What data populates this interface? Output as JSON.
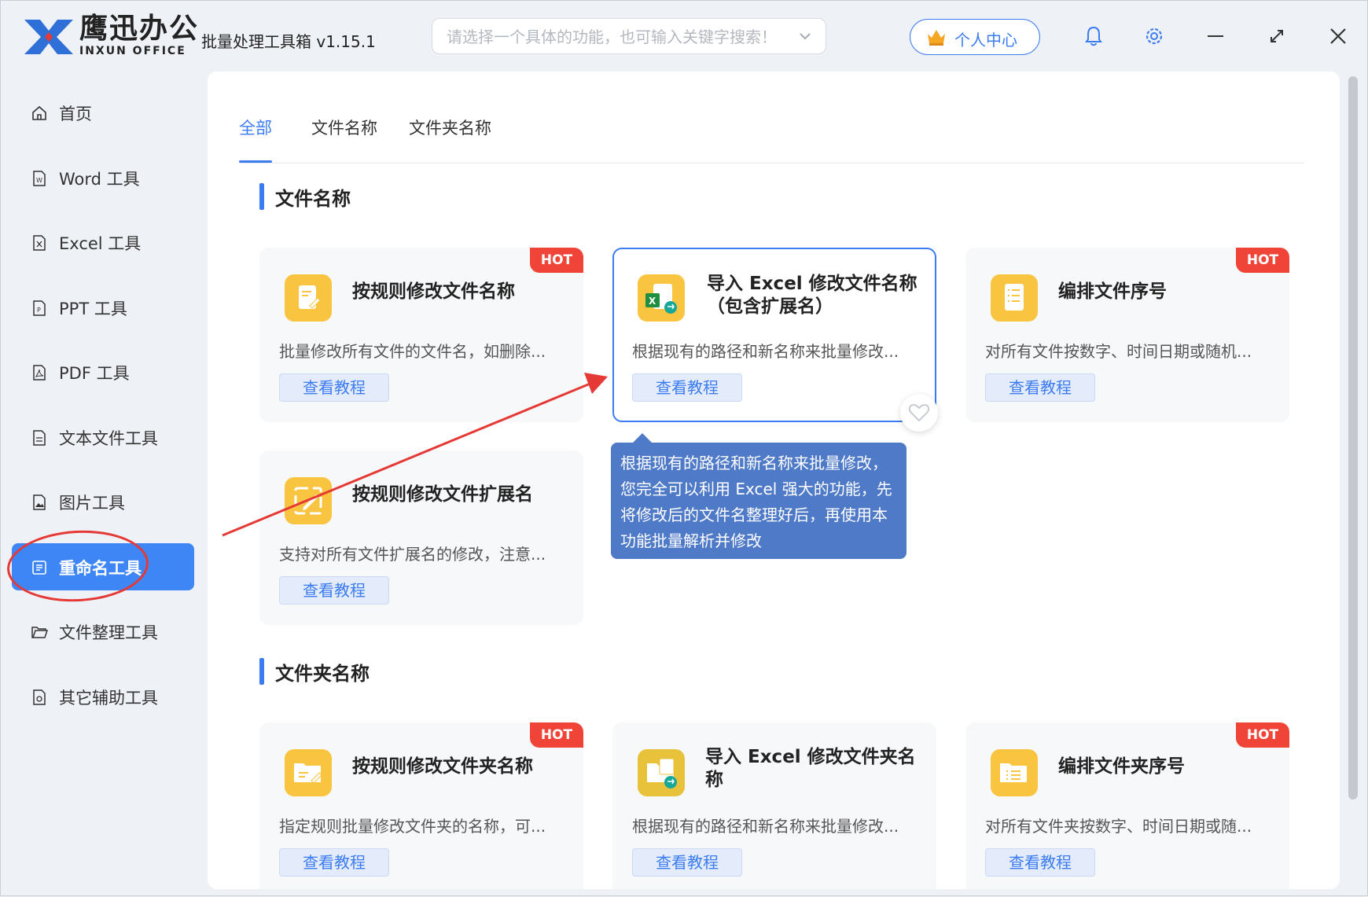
{
  "app": {
    "brand_cn": "鹰迅办公",
    "brand_en": "INXUN OFFICE",
    "title": "批量处理工具箱 v1.15.1"
  },
  "search": {
    "placeholder": "请选择一个具体的功能，也可输入关键字搜索！"
  },
  "header": {
    "user_center": "个人中心"
  },
  "sidebar": {
    "items": [
      {
        "label": "首页",
        "icon": "home-icon"
      },
      {
        "label": "Word 工具",
        "icon": "word-file-icon"
      },
      {
        "label": "Excel 工具",
        "icon": "excel-file-icon"
      },
      {
        "label": "PPT 工具",
        "icon": "ppt-file-icon"
      },
      {
        "label": "PDF 工具",
        "icon": "pdf-file-icon"
      },
      {
        "label": "文本文件工具",
        "icon": "text-file-icon"
      },
      {
        "label": "图片工具",
        "icon": "image-file-icon"
      },
      {
        "label": "重命名工具",
        "icon": "rename-icon",
        "active": true
      },
      {
        "label": "文件整理工具",
        "icon": "folder-open-icon"
      },
      {
        "label": "其它辅助工具",
        "icon": "utility-icon"
      }
    ]
  },
  "tabs": [
    {
      "label": "全部",
      "active": true
    },
    {
      "label": "文件名称"
    },
    {
      "label": "文件夹名称"
    }
  ],
  "sections": {
    "files": {
      "title": "文件名称",
      "cards": [
        {
          "title": "按规则修改文件名称",
          "desc": "批量修改所有文件的文件名，如删除...",
          "button": "查看教程",
          "badge": "HOT"
        },
        {
          "title": "导入 Excel 修改文件名称（包含扩展名）",
          "desc": "根据现有的路径和新名称来批量修改...",
          "button": "查看教程",
          "selected": true
        },
        {
          "title": "编排文件序号",
          "desc": "对所有文件按数字、时间日期或随机...",
          "button": "查看教程",
          "badge": "HOT"
        },
        {
          "title": "按规则修改文件扩展名",
          "desc": "支持对所有文件扩展名的修改，注意...",
          "button": "查看教程"
        }
      ]
    },
    "folders": {
      "title": "文件夹名称",
      "cards": [
        {
          "title": "按规则修改文件夹名称",
          "desc": "指定规则批量修改文件夹的名称，可...",
          "button": "查看教程",
          "badge": "HOT"
        },
        {
          "title": "导入 Excel 修改文件夹名称",
          "desc": "根据现有的路径和新名称来批量修改...",
          "button": "查看教程"
        },
        {
          "title": "编排文件夹序号",
          "desc": "对所有文件夹按数字、时间日期或随...",
          "button": "查看教程",
          "badge": "HOT"
        }
      ]
    }
  },
  "tooltip": {
    "text": "根据现有的路径和新名称来批量修改，您完全可以利用 Excel 强大的功能，先将修改后的文件名整理好后，再使用本功能批量解析并修改"
  },
  "colors": {
    "accent": "#3b7cf0",
    "active_nav": "#3e86f5",
    "hot_badge": "#f04438",
    "icon_yellow": "#f9c440",
    "annotation_red": "#e53935",
    "tooltip_bg": "#4f7ac7"
  }
}
